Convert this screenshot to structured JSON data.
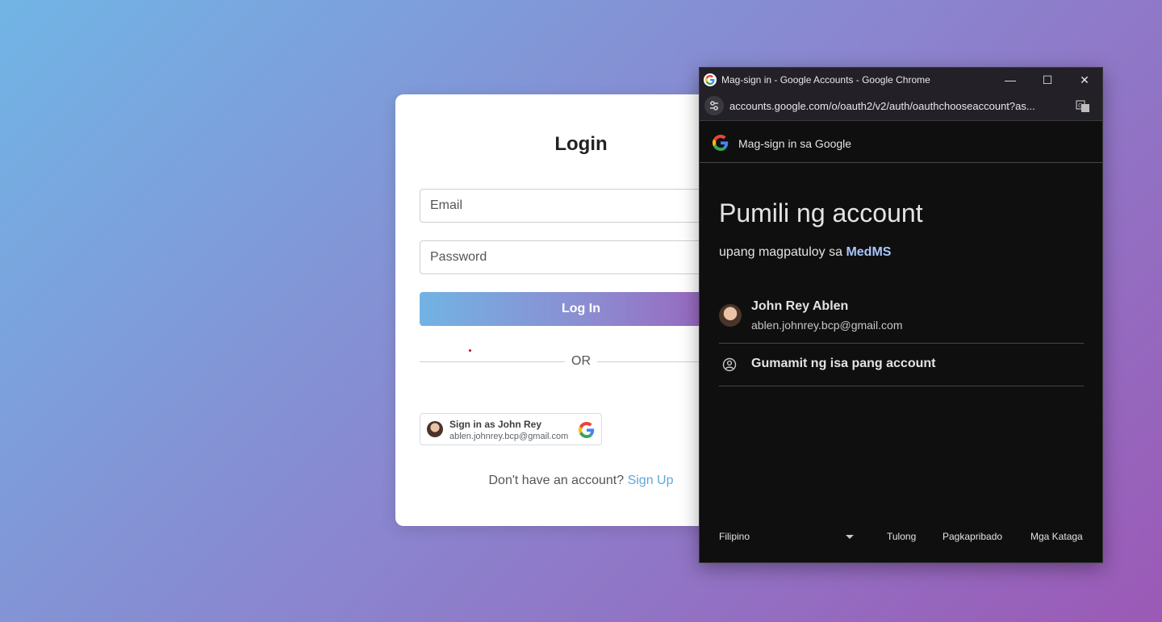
{
  "login": {
    "title": "Login",
    "email_placeholder": "Email",
    "password_placeholder": "Password",
    "login_button": "Log In",
    "or_text": "OR",
    "google_button": {
      "name": "Sign in as John Rey",
      "email": "ablen.johnrey.bcp@gmail.com"
    },
    "signup_prompt": "Don't have an account?",
    "signup_link": "Sign Up"
  },
  "popup": {
    "window_title": "Mag-sign in - Google Accounts - Google Chrome",
    "controls": {
      "minimize": "—",
      "maximize": "☐",
      "close": "✕"
    },
    "url": "accounts.google.com/o/oauth2/v2/auth/oauthchooseaccount?as...",
    "header_text": "Mag-sign in sa Google",
    "heading": "Pumili ng account",
    "subheading_prefix": "upang magpatuloy sa",
    "app_name": "MedMS",
    "account": {
      "name": "John Rey Ablen",
      "email": "ablen.johnrey.bcp@gmail.com"
    },
    "other_account": "Gumamit ng isa pang account",
    "footer": {
      "language": "Filipino",
      "help": "Tulong",
      "privacy": "Pagkapribado",
      "terms": "Mga Kataga"
    }
  },
  "colors": {
    "brand_gradient_start": "#72b3e4",
    "brand_gradient_end": "#9b5cb8",
    "link": "#5fa8dd",
    "app_name": "#a8c7fa",
    "popup_bg": "#0f0f10"
  },
  "icons": [
    "google-g-icon",
    "account-avatar-icon",
    "site-settings-icon",
    "translate-icon",
    "person-circle-icon",
    "minimize-icon",
    "maximize-icon",
    "close-icon",
    "dropdown-arrow-icon"
  ]
}
